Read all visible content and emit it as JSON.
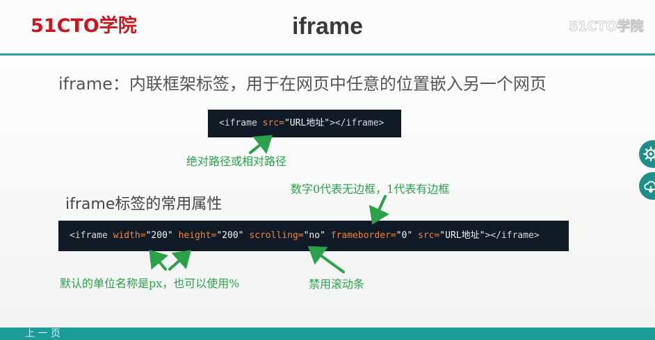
{
  "header": {
    "logo_left": "51CTO学院",
    "logo_right": "51CTO学院",
    "title": "iframe"
  },
  "content": {
    "definition": "iframe：内联框架标签，用于在网页中任意的位置嵌入另一个网页",
    "code1": {
      "open": "<iframe ",
      "attr": "src=",
      "value": "\"URL地址\"",
      "close": "></iframe>"
    },
    "annotation_path": "绝对路径或相对路径",
    "subtitle": "iframe标签的常用属性",
    "annotation_border": "数字0代表无边框，1代表有边框",
    "code2": {
      "open": "<iframe ",
      "attr_width": "width=",
      "val_width": "\"200\"",
      "attr_height": "height=",
      "val_height": "\"200\"",
      "attr_scrolling": "scrolling=",
      "val_scrolling": "\"no\"",
      "attr_frameborder": "frameborder=",
      "val_frameborder": "\"0\"",
      "attr_src": "src=",
      "val_src": "\"URL地址\"",
      "close": "></iframe>"
    },
    "annotation_unit": "默认的单位名称是px，也可以使用%",
    "annotation_scroll": "禁用滚动条"
  },
  "footer": {
    "text": "上 一 页"
  },
  "icons": {
    "side_button_1": "gear-icon",
    "side_button_2": "cloud-icon"
  },
  "colors": {
    "brand_red": "#c8171e",
    "teal": "#2aa0a0",
    "annotation_green": "#2ba24a",
    "code_bg": "#111b27",
    "code_attr": "#f0843a"
  }
}
